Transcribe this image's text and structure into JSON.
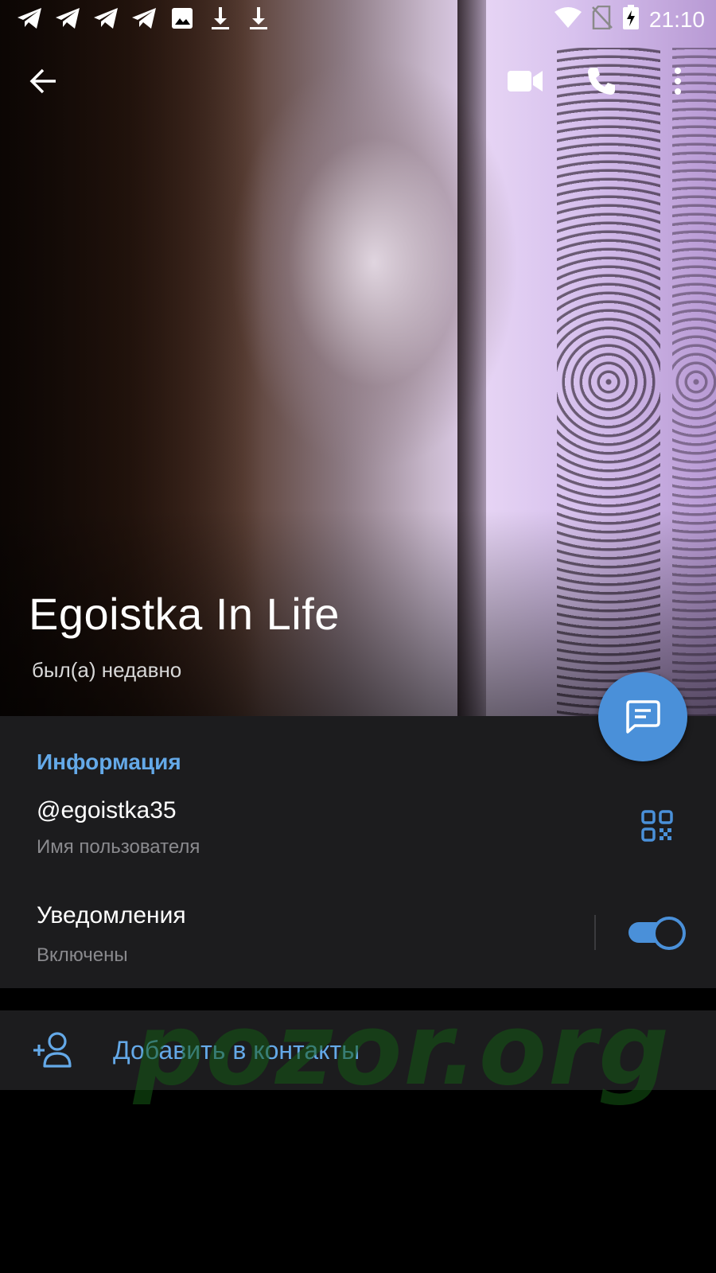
{
  "status_bar": {
    "time": "21:10",
    "left_icons": [
      "telegram-icon",
      "telegram-icon",
      "telegram-icon",
      "telegram-icon",
      "image-icon",
      "download-icon",
      "download-icon"
    ],
    "right_icons": [
      "wifi-icon",
      "no-sim-icon",
      "battery-charging-icon"
    ]
  },
  "top_bar": {
    "back_icon": "arrow-left-icon",
    "actions": [
      "video-call-icon",
      "phone-icon",
      "more-vertical-icon"
    ]
  },
  "profile": {
    "name": "Egoistka In Life",
    "last_seen": "был(а) недавно"
  },
  "fab": {
    "icon": "message-icon"
  },
  "info": {
    "section_title": "Информация",
    "username": "@egoistka35",
    "username_caption": "Имя пользователя",
    "notifications_label": "Уведомления",
    "notifications_caption": "Включены",
    "notifications_enabled": true
  },
  "add_contact": {
    "label": "Добавить в контакты",
    "icon": "add-person-icon"
  },
  "watermark": "pozor.org",
  "colors": {
    "accent": "#64a9e8",
    "fab": "#4a90d9",
    "panel": "#1c1c1e",
    "background": "#000000"
  }
}
